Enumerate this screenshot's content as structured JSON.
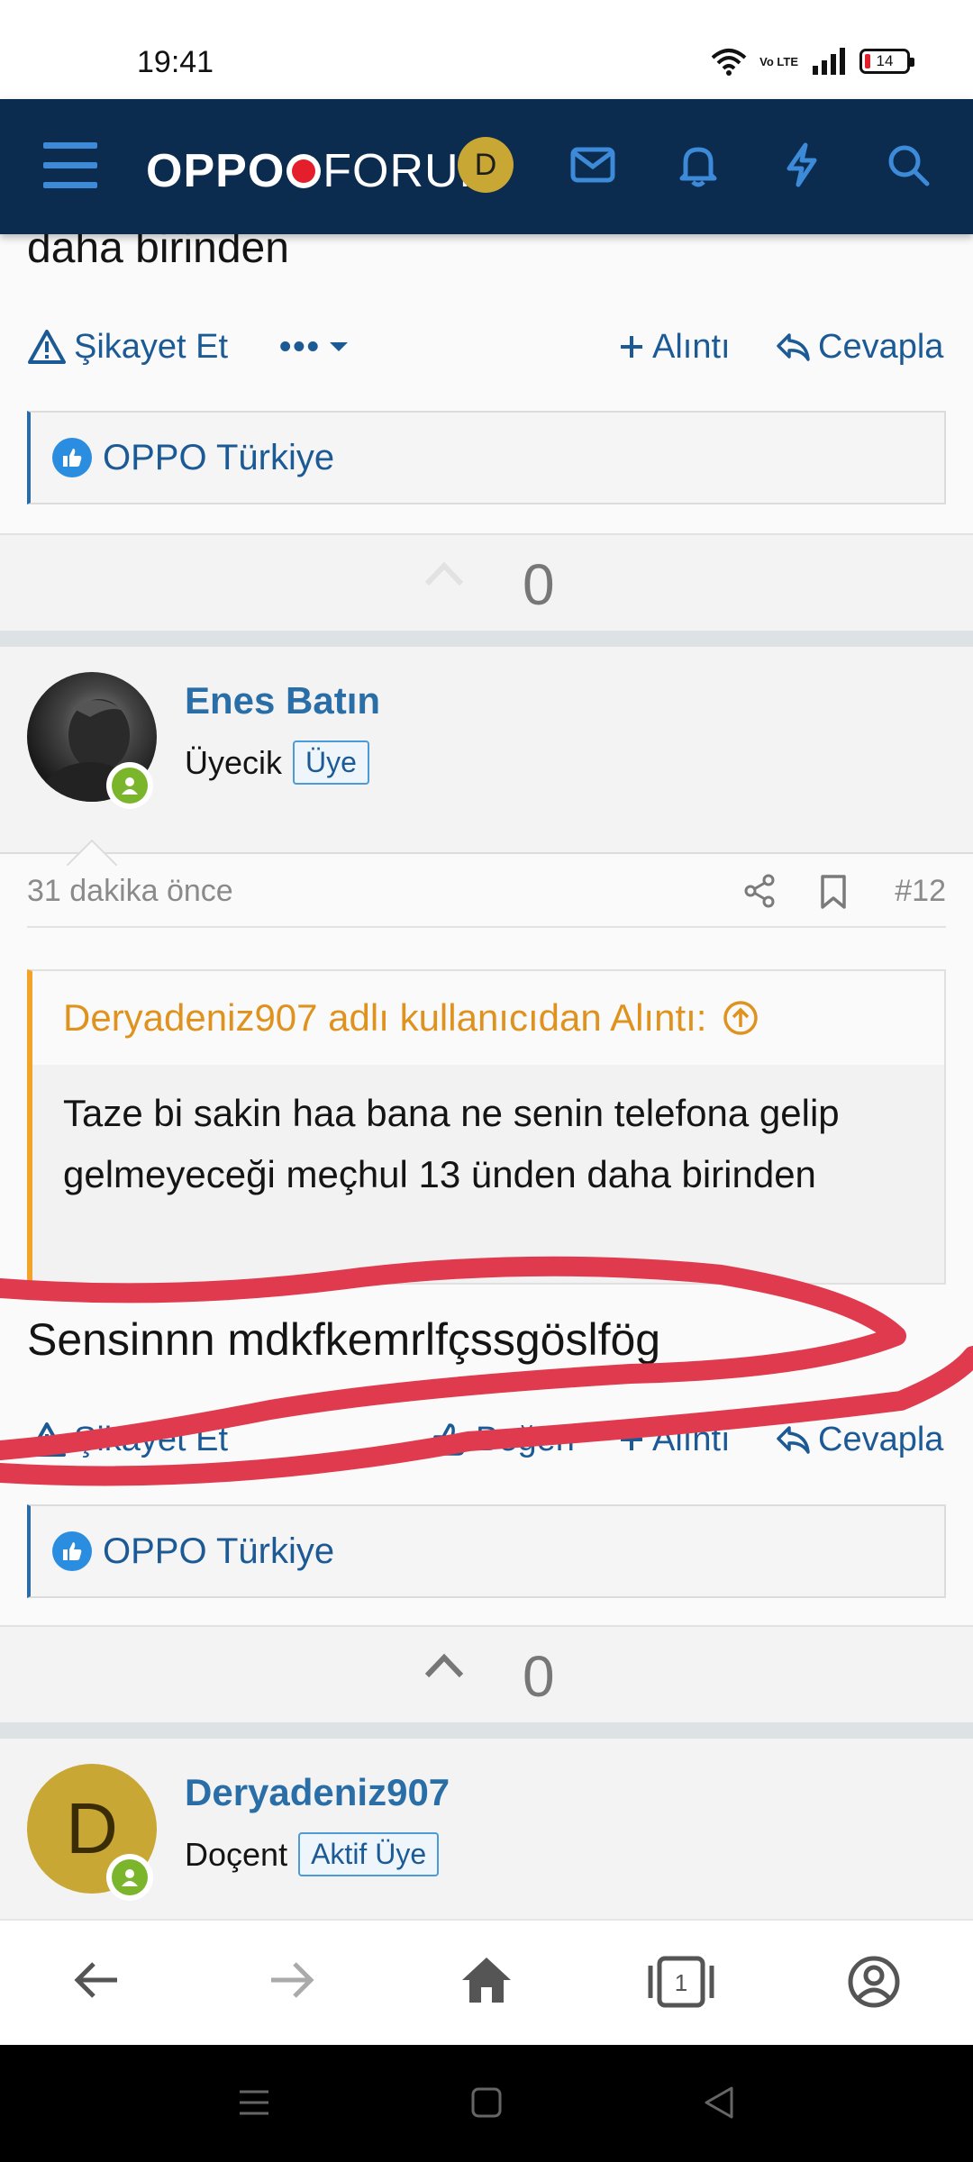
{
  "status_bar": {
    "time": "19:41",
    "battery": "14",
    "network_badge": "Vo LTE"
  },
  "navbar": {
    "logo_bold": "OPPO",
    "logo_thin": "FORUM",
    "avatar_letter": "D",
    "icons": [
      "menu-icon",
      "mail-icon",
      "bell-icon",
      "lightning-icon",
      "search-icon"
    ]
  },
  "post_prev": {
    "text_tail": "daha birinden",
    "report_label": "Şikayet Et",
    "more_label": "•••",
    "quote_label": "Alıntı",
    "reply_label": "Cevapla",
    "reaction_user": "OPPO Türkiye",
    "votes": "0"
  },
  "post_12": {
    "author": "Enes Batın",
    "user_title": "Üyecik",
    "badge": "Üye",
    "time_ago": "31 dakika önce",
    "post_number": "#12",
    "quote_header": "Deryadeniz907 adlı kullanıcıdan Alıntı:",
    "quote_text": "Taze bi sakin haa bana ne senin telefona gelip gelmeyeceği meçhul 13 ünden daha birinden",
    "reply_text": "Sensinnn mdkfkemrlfçssgöslfög",
    "report_label": "Şikayet Et",
    "like_label": "Beğen",
    "quote_label": "Alıntı",
    "reply_label": "Cevapla",
    "reaction_user": "OPPO Türkiye",
    "votes": "0"
  },
  "post_next": {
    "author": "Deryadeniz907",
    "avatar_letter": "D",
    "user_title": "Doçent",
    "badge": "Aktif Üye"
  },
  "colors": {
    "navbar": "#0b2b4f",
    "link": "#1c5a96",
    "quote_accent": "#f2a42a",
    "scribble": "#e03a4e"
  }
}
